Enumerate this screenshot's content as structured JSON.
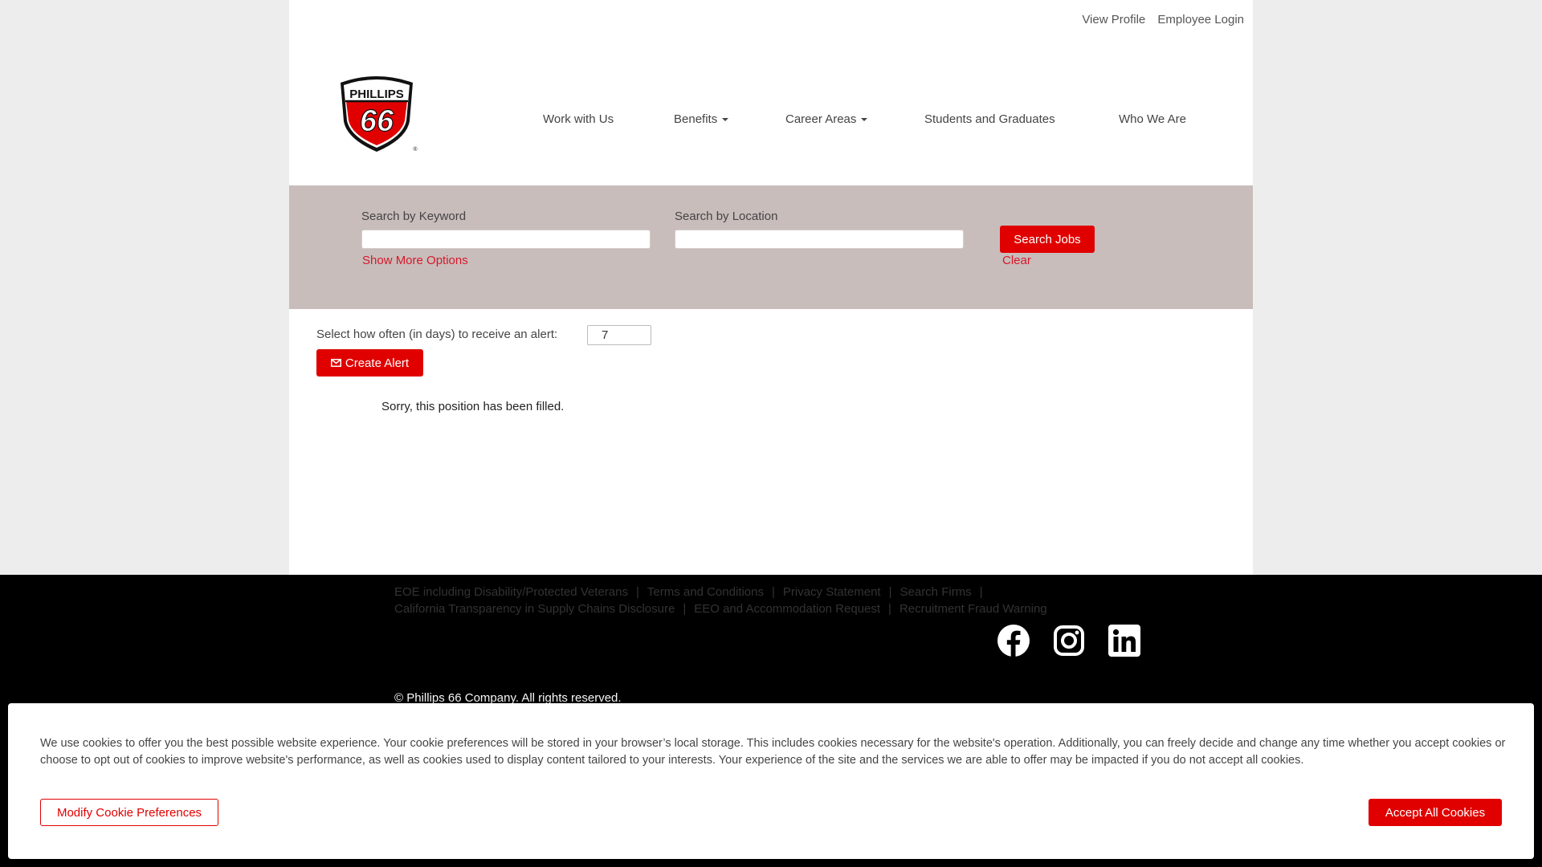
{
  "header": {
    "utility_links": [
      "View Profile",
      "Employee Login"
    ],
    "logo_text": {
      "brand": "PHILLIPS",
      "number": "66",
      "registered": "®"
    }
  },
  "nav": {
    "work": "Work with Us",
    "benefits": "Benefits",
    "career": "Career Areas",
    "students": "Students and Graduates",
    "who": "Who We Are"
  },
  "search": {
    "keyword_label": "Search by Keyword",
    "keyword_value": "",
    "location_label": "Search by Location",
    "location_value": "",
    "more_options": "Show More Options",
    "search_button": "Search Jobs",
    "clear": "Clear"
  },
  "alert": {
    "label": "Select how often (in days) to receive an alert:",
    "days": "7",
    "button": "Create Alert"
  },
  "message": "Sorry, this position has been filled.",
  "footer": {
    "row1": [
      "EOE including Disability/Protected Veterans",
      "Terms and Conditions",
      "Privacy Statement",
      "Search Firms"
    ],
    "row2": [
      "California Transparency in Supply Chains Disclosure",
      "EEO and Accommodation Request",
      "Recruitment Fraud Warning"
    ],
    "social_icons": [
      "facebook-icon",
      "instagram-icon",
      "linkedin-icon"
    ],
    "copyright": "© Phillips 66 Company. All rights reserved."
  },
  "cookie": {
    "text": "We use cookies to offer you the best possible website experience. Your cookie preferences will be stored in your browser’s local storage. This includes cookies necessary for the website's operation. Additionally, you can freely decide and change any time whether you accept cookies or choose to opt out of cookies to improve website's performance, as well as cookies used to display content tailored to your interests. Your experience of the site and the services we are able to offer may be impacted if you do not accept all cookies.",
    "modify": "Modify Cookie Preferences",
    "accept": "Accept All Cookies"
  },
  "colors": {
    "accent": "#e00000",
    "search_band": "#c8bdbb",
    "footer": "#000000",
    "page_bg": "#ededed"
  }
}
